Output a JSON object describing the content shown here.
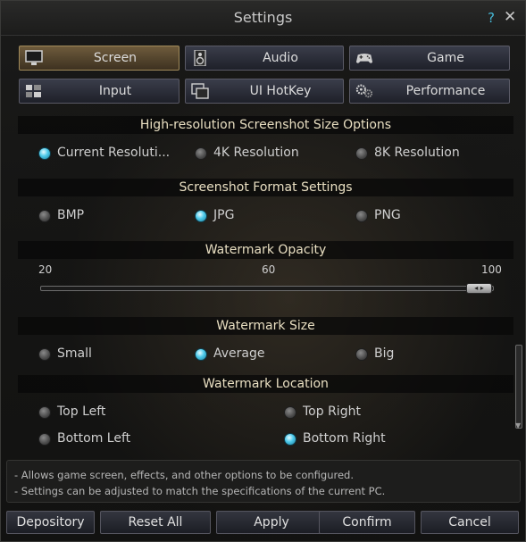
{
  "window": {
    "title": "Settings"
  },
  "titlebar": {
    "help_icon": "?",
    "close_icon": "✕"
  },
  "tabs": [
    {
      "label": "Screen",
      "icon": "monitor-icon",
      "active": true
    },
    {
      "label": "Audio",
      "icon": "speaker-icon",
      "active": false
    },
    {
      "label": "Game",
      "icon": "gamepad-icon",
      "active": false
    },
    {
      "label": "Input",
      "icon": "keyboard-icon",
      "active": false
    },
    {
      "label": "UI HotKey",
      "icon": "window-icon",
      "active": false
    },
    {
      "label": "Performance",
      "icon": "gears-icon",
      "active": false
    }
  ],
  "sections": {
    "screenshot_size": {
      "title": "High-resolution Screenshot Size Options",
      "options": [
        "Current Resoluti...",
        "4K Resolution",
        "8K Resolution"
      ],
      "selected": "Current Resoluti..."
    },
    "screenshot_format": {
      "title": "Screenshot Format Settings",
      "options": [
        "BMP",
        "JPG",
        "PNG"
      ],
      "selected": "JPG"
    },
    "watermark_opacity": {
      "title": "Watermark Opacity",
      "min_label": "20",
      "mid_label": "60",
      "max_label": "100",
      "value_fraction": 0.97
    },
    "watermark_size": {
      "title": "Watermark Size",
      "options": [
        "Small",
        "Average",
        "Big"
      ],
      "selected": "Average"
    },
    "watermark_location": {
      "title": "Watermark Location",
      "options": [
        "Top Left",
        "Top Right",
        "Bottom Left",
        "Bottom Right"
      ],
      "selected": "Bottom Right"
    }
  },
  "info": [
    "- Allows game screen, effects, and other options to be configured.",
    "- Settings can be adjusted to match the specifications of the current PC."
  ],
  "buttons": {
    "depository": "Depository",
    "reset_all": "Reset All",
    "apply": "Apply",
    "confirm": "Confirm",
    "cancel": "Cancel"
  },
  "colors": {
    "accent": "#4cc9ea",
    "active_tab": "#6e5b3c",
    "header_text": "#e9dfc2"
  }
}
